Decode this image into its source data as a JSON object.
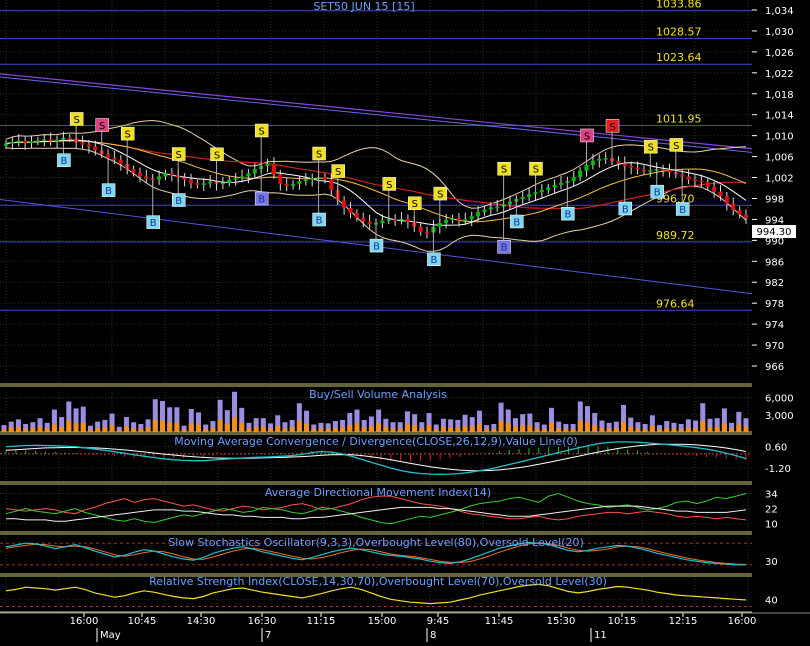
{
  "chart_data": [
    {
      "panel": "price",
      "type": "line",
      "title": "SET50 JUN 15  [15]",
      "ylim": [
        972,
        1035
      ],
      "yticks": [
        1034,
        1030,
        1026,
        1022,
        1018,
        1014,
        1010,
        1006,
        1002,
        998,
        994,
        990,
        986,
        982,
        978,
        974,
        970,
        966
      ],
      "last_price": "994.30",
      "levels": [
        {
          "value": 1033.86,
          "label": "1033.86"
        },
        {
          "value": 1028.57,
          "label": "1028.57"
        },
        {
          "value": 1023.64,
          "label": "1023.64"
        },
        {
          "value": 1011.95,
          "label": "1011.95"
        },
        {
          "value": 996.7,
          "label": "996.70"
        },
        {
          "value": 989.72,
          "label": "989.72"
        },
        {
          "value": 976.64,
          "label": "976.64"
        }
      ],
      "close": [
        1008.5,
        1008.8,
        1009,
        1008.6,
        1008.9,
        1009.1,
        1009.3,
        1008.9,
        1009.2,
        1009.6,
        1009.5,
        1008.7,
        1008.3,
        1007.9,
        1007.2,
        1006.4,
        1005.8,
        1005.4,
        1004.6,
        1003.6,
        1002.9,
        1002.2,
        1001.8,
        1001.6,
        1002.2,
        1002.8,
        1002.4,
        1002,
        1001.6,
        1000.9,
        1000.6,
        1000.9,
        1001.2,
        1000.8,
        1001,
        1001.6,
        1001.9,
        1002.2,
        1002.8,
        1003.6,
        1004.2,
        1004.6,
        1002.6,
        1000.8,
        1000.4,
        1000.8,
        1001.3,
        1001.6,
        1001.9,
        1002.1,
        1001.6,
        999.6,
        997.6,
        996.2,
        995.2,
        994.3,
        993.6,
        993.1,
        993.3,
        993.8,
        994,
        993.9,
        994.1,
        993.6,
        992.6,
        991.6,
        991.5,
        992.6,
        993.3,
        993.9,
        994.2,
        993.8,
        994,
        994.6,
        995.4,
        995.9,
        996.3,
        996.4,
        996.9,
        997.4,
        997.9,
        998.3,
        998.8,
        999.2,
        999.6,
        1000.1,
        1000.6,
        1001,
        1001.3,
        1002.1,
        1003.3,
        1004.4,
        1005.2,
        1005.6,
        1005.7,
        1005.1,
        1004.7,
        1004.2,
        1003.9,
        1003.6,
        1003.3,
        1003.4,
        1003.6,
        1003.5,
        1003,
        1002.6,
        1002.2,
        1001.6,
        1001.4,
        1001.1,
        1000.2,
        999.3,
        998.4,
        997,
        995.8,
        994.9,
        994.3
      ],
      "support_line": {
        "from": 997.8,
        "to": 979.8
      },
      "signals_buy": [
        9,
        16,
        23,
        27,
        40,
        49,
        58,
        67,
        78,
        80,
        88,
        97,
        102,
        106
      ],
      "signals_sell": [
        11,
        15,
        19,
        27,
        33,
        40,
        49,
        52,
        60,
        64,
        68,
        78,
        83,
        91,
        95,
        101,
        105
      ]
    },
    {
      "panel": "volume",
      "type": "bar",
      "title": "Buy/Sell Volume Analysis",
      "ylim": [
        0,
        8000
      ],
      "yticks": [
        "6,000",
        "3,000"
      ],
      "buy": [
        1200,
        1800,
        2200,
        1400,
        1700,
        2400,
        1600,
        3900,
        2600,
        5300,
        4100,
        4400,
        1100,
        1800,
        2100,
        3200,
        900,
        2600,
        1700,
        1400,
        2200,
        5700,
        5400,
        4300,
        4300,
        1100,
        4000,
        3400,
        1300,
        1900,
        5600,
        3800,
        7000,
        4200,
        1600,
        2400,
        2400,
        1500,
        2900,
        1700,
        2100,
        5000,
        3700,
        1300,
        1600,
        1500,
        1900,
        2100,
        3300,
        3900,
        2100,
        2700,
        3900,
        2300,
        1700,
        1700,
        3600,
        3100,
        1700,
        3300,
        1300,
        2300,
        2200,
        2100,
        3000,
        2600,
        3700,
        1200,
        1400,
        5100,
        3900,
        2400,
        3100,
        3200,
        1700,
        1300,
        4200,
        1800,
        1400,
        1400,
        5300,
        4500,
        3300,
        2000,
        1600,
        1800,
        4700,
        2500,
        1700,
        1400,
        2900,
        1200,
        1900,
        1600,
        1400,
        2200,
        2000,
        5000,
        2300,
        2400,
        4100,
        1600,
        3500,
        2400
      ],
      "sell": [
        500,
        800,
        900,
        500,
        700,
        900,
        600,
        1300,
        900,
        2000,
        1500,
        1600,
        400,
        700,
        800,
        1200,
        300,
        1000,
        600,
        500,
        800,
        2100,
        2000,
        1600,
        1600,
        400,
        1500,
        1300,
        500,
        700,
        2100,
        1400,
        2600,
        1600,
        600,
        900,
        900,
        600,
        1100,
        600,
        800,
        1900,
        1400,
        500,
        600,
        600,
        700,
        800,
        1200,
        1500,
        800,
        1000,
        1500,
        900,
        600,
        600,
        1300,
        1200,
        600,
        1200,
        500,
        900,
        800,
        800,
        1100,
        1000,
        1400,
        500,
        500,
        1900,
        1500,
        900,
        1200,
        1200,
        600,
        500,
        1600,
        700,
        500,
        500,
        2000,
        1700,
        1200,
        700,
        600,
        700,
        1800,
        900,
        600,
        500,
        1100,
        500,
        700,
        600,
        500,
        800,
        700,
        1900,
        900,
        900,
        1500,
        600,
        1300,
        900
      ]
    },
    {
      "panel": "macd",
      "type": "line",
      "title": "Moving Average Convergence / Divergence(CLOSE,26,12,9),Value Line(0)",
      "ylim": [
        -2.2,
        1.5
      ],
      "yticks": [
        "0.60",
        "-1.20"
      ],
      "macd": [
        0.6,
        0.65,
        0.7,
        0.72,
        0.7,
        0.68,
        0.65,
        0.6,
        0.5,
        0.4,
        0.3,
        0.18,
        0.05,
        -0.08,
        -0.2,
        -0.32,
        -0.42,
        -0.5,
        -0.55,
        -0.58,
        -0.58,
        -0.52,
        -0.45,
        -0.4,
        -0.35,
        -0.3,
        -0.28,
        -0.25,
        -0.2,
        -0.15,
        -0.05,
        0.1,
        0.2,
        0.15,
        0.0,
        -0.2,
        -0.45,
        -0.7,
        -0.95,
        -1.2,
        -1.4,
        -1.55,
        -1.65,
        -1.7,
        -1.72,
        -1.7,
        -1.65,
        -1.55,
        -1.42,
        -1.28,
        -1.1,
        -0.9,
        -0.7,
        -0.5,
        -0.3,
        -0.1,
        0.1,
        0.3,
        0.5,
        0.68,
        0.85,
        0.95,
        1.0,
        1.0,
        0.98,
        0.92,
        0.85,
        0.78,
        0.7,
        0.62,
        0.52,
        0.4,
        0.25,
        0.05,
        -0.15,
        -0.4
      ],
      "signal": [
        0.3,
        0.35,
        0.4,
        0.45,
        0.5,
        0.52,
        0.53,
        0.53,
        0.52,
        0.5,
        0.46,
        0.4,
        0.33,
        0.25,
        0.16,
        0.07,
        -0.02,
        -0.1,
        -0.18,
        -0.25,
        -0.3,
        -0.34,
        -0.36,
        -0.37,
        -0.37,
        -0.36,
        -0.34,
        -0.32,
        -0.3,
        -0.27,
        -0.23,
        -0.18,
        -0.12,
        -0.08,
        -0.06,
        -0.08,
        -0.14,
        -0.24,
        -0.36,
        -0.5,
        -0.65,
        -0.8,
        -0.95,
        -1.08,
        -1.2,
        -1.3,
        -1.37,
        -1.41,
        -1.42,
        -1.4,
        -1.35,
        -1.27,
        -1.16,
        -1.03,
        -0.88,
        -0.72,
        -0.55,
        -0.37,
        -0.2,
        -0.02,
        0.15,
        0.31,
        0.45,
        0.57,
        0.67,
        0.74,
        0.79,
        0.81,
        0.81,
        0.79,
        0.75,
        0.68,
        0.6,
        0.49,
        0.36,
        0.2
      ]
    },
    {
      "panel": "adx",
      "type": "line",
      "title": "Average Directional Movement Index(14)",
      "ylim": [
        5,
        40
      ],
      "yticks": [
        "34",
        "22",
        "10"
      ],
      "adx": [
        14,
        14,
        13,
        13,
        13,
        12,
        12,
        13,
        14,
        15,
        16,
        17,
        18,
        19,
        20,
        21,
        21,
        21,
        20,
        20,
        19,
        18,
        17,
        17,
        16,
        16,
        15,
        15,
        15,
        14,
        14,
        15,
        15,
        16,
        17,
        18,
        19,
        20,
        21,
        22,
        23,
        23,
        23,
        23,
        22,
        22,
        21,
        20,
        19,
        18,
        17,
        16,
        16,
        16,
        17,
        18,
        19,
        20,
        21,
        22,
        23,
        24,
        24,
        24,
        24,
        23,
        22,
        21,
        20,
        20,
        19,
        19,
        19,
        19,
        20,
        21
      ],
      "plus_di": [
        18,
        20,
        22,
        20,
        19,
        18,
        20,
        22,
        19,
        17,
        15,
        13,
        12,
        14,
        12,
        11,
        13,
        15,
        17,
        16,
        18,
        20,
        22,
        21,
        19,
        20,
        23,
        22,
        21,
        19,
        18,
        20,
        23,
        22,
        20,
        18,
        15,
        13,
        11,
        10,
        12,
        14,
        16,
        15,
        17,
        19,
        21,
        24,
        26,
        27,
        28,
        30,
        31,
        29,
        27,
        32,
        34,
        31,
        28,
        26,
        25,
        23,
        24,
        25,
        23,
        21,
        22,
        24,
        27,
        28,
        26,
        28,
        31,
        30,
        32,
        34
      ],
      "minus_di": [
        22,
        21,
        20,
        21,
        22,
        21,
        19,
        18,
        21,
        23,
        26,
        28,
        30,
        27,
        29,
        30,
        28,
        26,
        24,
        25,
        23,
        21,
        20,
        22,
        24,
        23,
        21,
        22,
        23,
        25,
        26,
        24,
        21,
        22,
        24,
        26,
        29,
        31,
        32,
        32,
        30,
        28,
        26,
        25,
        24,
        22,
        20,
        18,
        17,
        16,
        15,
        14,
        14,
        15,
        16,
        14,
        13,
        14,
        16,
        17,
        18,
        19,
        19,
        18,
        19,
        20,
        19,
        18,
        16,
        15,
        16,
        15,
        14,
        15,
        14,
        13
      ]
    },
    {
      "panel": "stochastic",
      "type": "line",
      "title": "Slow Stochastics Oscillator(9,3,3),Overbought Level(80),Oversold Level(20)",
      "ylim": [
        0,
        100
      ],
      "yticks": [
        "30"
      ],
      "k": [
        70,
        75,
        80,
        78,
        72,
        65,
        70,
        76,
        68,
        58,
        50,
        42,
        46,
        55,
        62,
        58,
        50,
        42,
        36,
        33,
        40,
        52,
        60,
        66,
        70,
        64,
        56,
        50,
        44,
        38,
        34,
        40,
        48,
        56,
        62,
        66,
        62,
        56,
        50,
        46,
        44,
        40,
        36,
        30,
        26,
        24,
        28,
        36,
        46,
        56,
        66,
        72,
        78,
        82,
        80,
        76,
        68,
        60,
        56,
        60,
        66,
        70,
        74,
        72,
        66,
        60,
        52,
        46,
        40,
        34,
        30,
        26,
        24,
        22,
        20,
        20
      ],
      "d": [
        66,
        70,
        74,
        77,
        76,
        72,
        70,
        72,
        70,
        64,
        56,
        48,
        44,
        48,
        54,
        58,
        56,
        50,
        42,
        36,
        35,
        42,
        50,
        58,
        64,
        66,
        62,
        56,
        50,
        44,
        38,
        36,
        40,
        46,
        54,
        60,
        64,
        62,
        56,
        50,
        46,
        44,
        40,
        35,
        30,
        27,
        26,
        29,
        36,
        45,
        55,
        64,
        72,
        78,
        80,
        79,
        74,
        66,
        60,
        58,
        60,
        64,
        70,
        72,
        70,
        65,
        58,
        51,
        45,
        39,
        34,
        30,
        26,
        24,
        22,
        21
      ]
    },
    {
      "panel": "rsi",
      "type": "line",
      "title": "Relative Strength Index(CLOSE,14,30,70),Overbought Level(70),Oversold Level(30)",
      "ylim": [
        25,
        70
      ],
      "yticks": [
        "40"
      ],
      "rsi": [
        52,
        54,
        57,
        56,
        55,
        53,
        55,
        57,
        54,
        49,
        46,
        43,
        45,
        49,
        52,
        50,
        47,
        44,
        42,
        41,
        44,
        49,
        52,
        55,
        56,
        53,
        50,
        48,
        46,
        44,
        42,
        45,
        48,
        52,
        55,
        57,
        54,
        49,
        44,
        40,
        38,
        36,
        35,
        34,
        35,
        36,
        39,
        42,
        46,
        49,
        52,
        55,
        58,
        60,
        61,
        59,
        55,
        51,
        49,
        51,
        54,
        56,
        58,
        57,
        55,
        53,
        50,
        48,
        46,
        45,
        44,
        43,
        42,
        41,
        40,
        39
      ]
    },
    {
      "panel": "time_axis",
      "type": "axis",
      "time_labels": [
        "16:00",
        "10:45",
        "14:30",
        "16:30",
        "11:15",
        "15:00",
        "9:45",
        "11:45",
        "15:30",
        "10:15",
        "12:15",
        "16:00"
      ],
      "date_labels": [
        "May",
        "7",
        "8",
        "11"
      ]
    }
  ],
  "colors": {
    "background": "#000000",
    "grid": "#2a2a2a",
    "panel_border": "#c8c878",
    "level_line": "#4444cc",
    "up_candle": "#00c000",
    "down_candle": "#e01010",
    "volume_buy": "#9b8ee0",
    "volume_sell": "#f09020",
    "buy_signal_fill": "#7fd8ee",
    "buy_signal_fill_alt": "#7777dd",
    "sell_signal_fill": "#f0e020",
    "sell_signal_fill_alt": "#e04080"
  },
  "labels": {
    "buy_signal": "B",
    "sell_signal": "S"
  }
}
